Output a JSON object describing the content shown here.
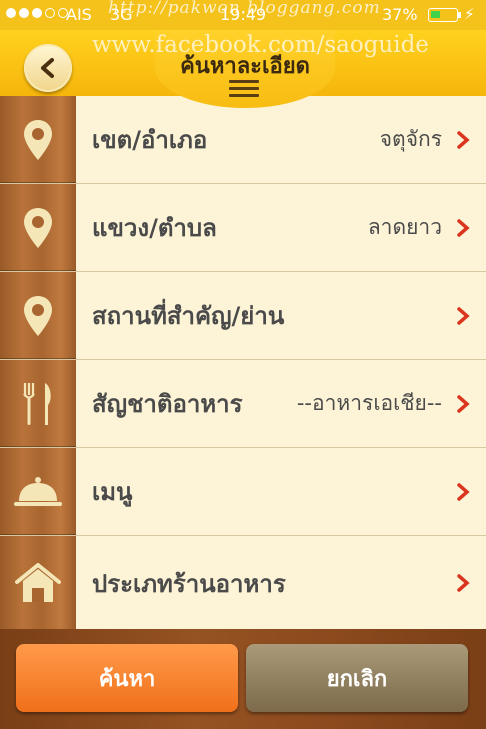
{
  "status_bar": {
    "carrier": "AIS",
    "network": "3G",
    "time": "19:49",
    "battery": "37%"
  },
  "watermark": {
    "line1": "http://pakwon.bloggang.com",
    "line2": "www.facebook.com/saoguide"
  },
  "header": {
    "title": "ค้นหาละเอียด",
    "back_icon": "chevron-left-icon",
    "menu_icon": "hamburger-menu-icon"
  },
  "rows": [
    {
      "label": "เขต/อำเภอ",
      "value": "จตุจักร",
      "icon": "map-pin-icon"
    },
    {
      "label": "แขวง/ตำบล",
      "value": "ลาดยาว",
      "icon": "map-pin-icon"
    },
    {
      "label": "สถานที่สำคัญ/ย่าน",
      "value": "",
      "icon": "map-pin-icon"
    },
    {
      "label": "สัญชาติอาหาร",
      "value": "--อาหารเอเชีย--",
      "icon": "fork-knife-icon"
    },
    {
      "label": "เมนู",
      "value": "",
      "icon": "food-cloche-icon"
    },
    {
      "label": "ประเภทร้านอาหาร",
      "value": "",
      "icon": "house-icon"
    }
  ],
  "buttons": {
    "search": "ค้นหา",
    "cancel": "ยกเลิก"
  },
  "colors": {
    "header": "#f6b50b",
    "accent_chevron": "#d9351f",
    "search_button": "#f07a20",
    "cancel_button": "#8d7b58"
  }
}
